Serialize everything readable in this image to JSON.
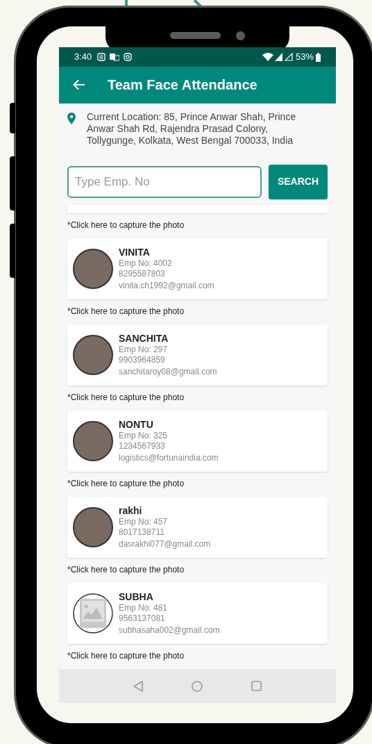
{
  "status_bar": {
    "time": "3:40",
    "battery": "53%"
  },
  "toolbar": {
    "title": "Team Face Attendance"
  },
  "location": {
    "text": "Current Location: 85, Prince Anwar Shah, Prince Anwar Shah Rd, Rajendra Prasad Colony, Tollygunge, Kolkata, West Bengal 700033, India"
  },
  "search": {
    "placeholder": "Type Emp. No",
    "button": "SEARCH"
  },
  "list": {
    "top_caption": "*Click here to capture the photo",
    "employees": [
      {
        "name": "VINITA",
        "emp_no": "Emp No: 4002",
        "phone": "8295587803",
        "email": "vinita.ch1992@gmail.com",
        "has_photo": true,
        "caption": "*Click here to capture the photo"
      },
      {
        "name": "SANCHITA",
        "emp_no": "Emp No: 297",
        "phone": "9903964859",
        "email": "sanchitaroy08@gmail.com",
        "has_photo": true,
        "caption": "*Click here to capture the photo"
      },
      {
        "name": "NONTU",
        "emp_no": "Emp No: 325",
        "phone": "1234567933",
        "email": "logistics@fortunaindia.com",
        "has_photo": true,
        "caption": "*Click here to capture the photo"
      },
      {
        "name": "rakhi",
        "emp_no": "Emp No: 457",
        "phone": "8017138711",
        "email": "dasrakhi077@gmail.com",
        "has_photo": true,
        "caption": "*Click here to capture the photo"
      },
      {
        "name": "SUBHA",
        "emp_no": "Emp No: 481",
        "phone": "9563137081",
        "email": "subhasaha002@gmail.com",
        "has_photo": false,
        "caption": "*Click here to capture the photo"
      }
    ]
  }
}
